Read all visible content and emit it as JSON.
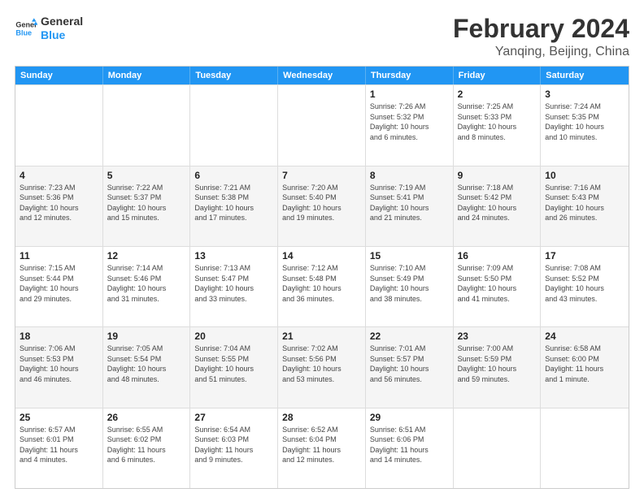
{
  "logo": {
    "line1": "General",
    "line2": "Blue"
  },
  "title": "February 2024",
  "subtitle": "Yanqing, Beijing, China",
  "days": [
    "Sunday",
    "Monday",
    "Tuesday",
    "Wednesday",
    "Thursday",
    "Friday",
    "Saturday"
  ],
  "weeks": [
    [
      {
        "day": "",
        "info": ""
      },
      {
        "day": "",
        "info": ""
      },
      {
        "day": "",
        "info": ""
      },
      {
        "day": "",
        "info": ""
      },
      {
        "day": "1",
        "info": "Sunrise: 7:26 AM\nSunset: 5:32 PM\nDaylight: 10 hours\nand 6 minutes."
      },
      {
        "day": "2",
        "info": "Sunrise: 7:25 AM\nSunset: 5:33 PM\nDaylight: 10 hours\nand 8 minutes."
      },
      {
        "day": "3",
        "info": "Sunrise: 7:24 AM\nSunset: 5:35 PM\nDaylight: 10 hours\nand 10 minutes."
      }
    ],
    [
      {
        "day": "4",
        "info": "Sunrise: 7:23 AM\nSunset: 5:36 PM\nDaylight: 10 hours\nand 12 minutes."
      },
      {
        "day": "5",
        "info": "Sunrise: 7:22 AM\nSunset: 5:37 PM\nDaylight: 10 hours\nand 15 minutes."
      },
      {
        "day": "6",
        "info": "Sunrise: 7:21 AM\nSunset: 5:38 PM\nDaylight: 10 hours\nand 17 minutes."
      },
      {
        "day": "7",
        "info": "Sunrise: 7:20 AM\nSunset: 5:40 PM\nDaylight: 10 hours\nand 19 minutes."
      },
      {
        "day": "8",
        "info": "Sunrise: 7:19 AM\nSunset: 5:41 PM\nDaylight: 10 hours\nand 21 minutes."
      },
      {
        "day": "9",
        "info": "Sunrise: 7:18 AM\nSunset: 5:42 PM\nDaylight: 10 hours\nand 24 minutes."
      },
      {
        "day": "10",
        "info": "Sunrise: 7:16 AM\nSunset: 5:43 PM\nDaylight: 10 hours\nand 26 minutes."
      }
    ],
    [
      {
        "day": "11",
        "info": "Sunrise: 7:15 AM\nSunset: 5:44 PM\nDaylight: 10 hours\nand 29 minutes."
      },
      {
        "day": "12",
        "info": "Sunrise: 7:14 AM\nSunset: 5:46 PM\nDaylight: 10 hours\nand 31 minutes."
      },
      {
        "day": "13",
        "info": "Sunrise: 7:13 AM\nSunset: 5:47 PM\nDaylight: 10 hours\nand 33 minutes."
      },
      {
        "day": "14",
        "info": "Sunrise: 7:12 AM\nSunset: 5:48 PM\nDaylight: 10 hours\nand 36 minutes."
      },
      {
        "day": "15",
        "info": "Sunrise: 7:10 AM\nSunset: 5:49 PM\nDaylight: 10 hours\nand 38 minutes."
      },
      {
        "day": "16",
        "info": "Sunrise: 7:09 AM\nSunset: 5:50 PM\nDaylight: 10 hours\nand 41 minutes."
      },
      {
        "day": "17",
        "info": "Sunrise: 7:08 AM\nSunset: 5:52 PM\nDaylight: 10 hours\nand 43 minutes."
      }
    ],
    [
      {
        "day": "18",
        "info": "Sunrise: 7:06 AM\nSunset: 5:53 PM\nDaylight: 10 hours\nand 46 minutes."
      },
      {
        "day": "19",
        "info": "Sunrise: 7:05 AM\nSunset: 5:54 PM\nDaylight: 10 hours\nand 48 minutes."
      },
      {
        "day": "20",
        "info": "Sunrise: 7:04 AM\nSunset: 5:55 PM\nDaylight: 10 hours\nand 51 minutes."
      },
      {
        "day": "21",
        "info": "Sunrise: 7:02 AM\nSunset: 5:56 PM\nDaylight: 10 hours\nand 53 minutes."
      },
      {
        "day": "22",
        "info": "Sunrise: 7:01 AM\nSunset: 5:57 PM\nDaylight: 10 hours\nand 56 minutes."
      },
      {
        "day": "23",
        "info": "Sunrise: 7:00 AM\nSunset: 5:59 PM\nDaylight: 10 hours\nand 59 minutes."
      },
      {
        "day": "24",
        "info": "Sunrise: 6:58 AM\nSunset: 6:00 PM\nDaylight: 11 hours\nand 1 minute."
      }
    ],
    [
      {
        "day": "25",
        "info": "Sunrise: 6:57 AM\nSunset: 6:01 PM\nDaylight: 11 hours\nand 4 minutes."
      },
      {
        "day": "26",
        "info": "Sunrise: 6:55 AM\nSunset: 6:02 PM\nDaylight: 11 hours\nand 6 minutes."
      },
      {
        "day": "27",
        "info": "Sunrise: 6:54 AM\nSunset: 6:03 PM\nDaylight: 11 hours\nand 9 minutes."
      },
      {
        "day": "28",
        "info": "Sunrise: 6:52 AM\nSunset: 6:04 PM\nDaylight: 11 hours\nand 12 minutes."
      },
      {
        "day": "29",
        "info": "Sunrise: 6:51 AM\nSunset: 6:06 PM\nDaylight: 11 hours\nand 14 minutes."
      },
      {
        "day": "",
        "info": ""
      },
      {
        "day": "",
        "info": ""
      }
    ]
  ]
}
